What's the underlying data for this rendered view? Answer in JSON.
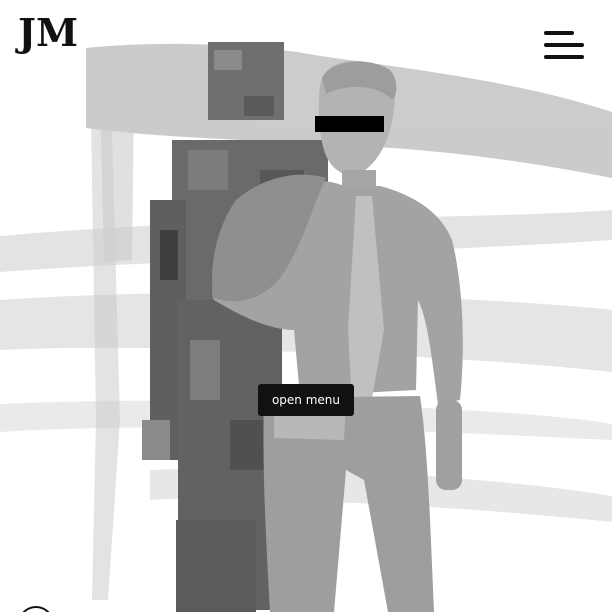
{
  "header": {
    "logo_text": "JM",
    "menu_icon": "hamburger-icon"
  },
  "hero": {
    "image_icon": "statue-figures-image",
    "redaction": "censor-bar"
  },
  "tooltip": {
    "label": "open menu"
  },
  "colors": {
    "background": "#ffffff",
    "text": "#111111",
    "tooltip_bg": "#111111",
    "tooltip_text": "#ffffff",
    "stroke_gray": "#c9c9c9",
    "figure_gray": "#9a9a98"
  }
}
